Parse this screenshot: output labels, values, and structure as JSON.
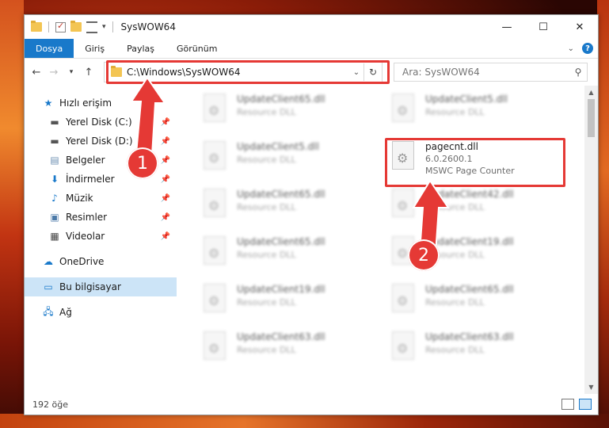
{
  "window": {
    "title": "SysWOW64",
    "controls": [
      "—",
      "☐",
      "✕"
    ]
  },
  "ribbon": {
    "tabs": [
      "Dosya",
      "Giriş",
      "Paylaş",
      "Görünüm"
    ]
  },
  "navbar": {
    "address": "C:\\Windows\\SysWOW64",
    "search_placeholder": "Ara: SysWOW64"
  },
  "sidebar": {
    "items": [
      {
        "label": "Hızlı erişim",
        "icon": "star-icon"
      },
      {
        "label": "Yerel Disk (C:)",
        "icon": "drive-icon"
      },
      {
        "label": "Yerel Disk (D:)",
        "icon": "drive-icon"
      },
      {
        "label": "Belgeler",
        "icon": "documents-icon"
      },
      {
        "label": "İndirmeler",
        "icon": "download-icon"
      },
      {
        "label": "Müzik",
        "icon": "music-icon"
      },
      {
        "label": "Resimler",
        "icon": "pictures-icon"
      },
      {
        "label": "Videolar",
        "icon": "video-icon"
      },
      {
        "label": "OneDrive",
        "icon": "cloud-icon"
      },
      {
        "label": "Bu bilgisayar",
        "icon": "computer-icon"
      },
      {
        "label": "Ağ",
        "icon": "network-icon"
      }
    ]
  },
  "files": {
    "left": [
      {
        "name": "UpdateClient65.dll",
        "desc": "Resource DLL"
      },
      {
        "name": "UpdateClient5.dll",
        "desc": "Resource DLL"
      },
      {
        "name": "UpdateClient65.dll",
        "desc": "Resource DLL"
      },
      {
        "name": "UpdateClient65.dll",
        "desc": "Resource DLL"
      },
      {
        "name": "UpdateClient19.dll",
        "desc": "Resource DLL"
      },
      {
        "name": "UpdateClient63.dll",
        "desc": "Resource DLL"
      }
    ],
    "right": [
      {
        "name": "UpdateClient5.dll",
        "desc": "Resource DLL"
      },
      {
        "name": "pagecnt.dll",
        "version": "6.0.2600.1",
        "desc": "MSWC Page Counter"
      },
      {
        "name": "UpdateClient42.dll",
        "desc": "Resource DLL"
      },
      {
        "name": "UpdateClient19.dll",
        "desc": "Resource DLL"
      },
      {
        "name": "UpdateClient65.dll",
        "desc": "Resource DLL"
      },
      {
        "name": "UpdateClient63.dll",
        "desc": "Resource DLL"
      }
    ]
  },
  "status": {
    "count": "192 öğe"
  },
  "annotations": {
    "step1": "1",
    "step2": "2",
    "accent": "#e53935"
  }
}
